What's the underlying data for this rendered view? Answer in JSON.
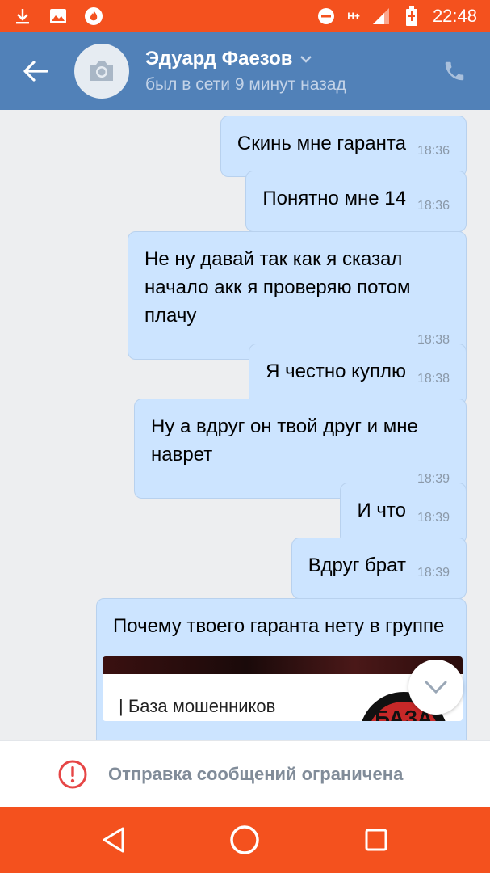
{
  "status_bar": {
    "time": "22:48",
    "network": "H+",
    "icons": [
      "download-icon",
      "image-icon",
      "fire-app-icon",
      "do-not-disturb-icon",
      "network-type-icon",
      "signal-icon",
      "battery-charging-icon"
    ]
  },
  "header": {
    "contact_name": "Эдуард Фаезов",
    "last_seen": "был в сети 9 минут назад"
  },
  "messages": [
    {
      "text": "Скинь мне гаранта",
      "time": "18:36"
    },
    {
      "text": "Понятно мне 14",
      "time": "18:36"
    },
    {
      "text": "Не ну давай так как я сказал начало акк я проверяю потом плачу",
      "time": "18:38"
    },
    {
      "text": "Я честно куплю",
      "time": "18:38"
    },
    {
      "text": "Ну а вдруг он твой друг и мне наврет",
      "time": "18:39"
    },
    {
      "text": "И что",
      "time": "18:39"
    },
    {
      "text": "Вдруг брат",
      "time": "18:39"
    },
    {
      "text": "Почему твоего гаранта нету в группе",
      "time": ""
    }
  ],
  "link_preview": {
    "title": "| База мошенников",
    "logo_text": "БАЗА"
  },
  "restriction_banner": {
    "text": "Отправка сообщений ограничена"
  },
  "colors": {
    "status_bar": "#f4511e",
    "header": "#5181b8",
    "bubble": "#cce4ff",
    "chat_bg": "#edeef0",
    "warning": "#e64646"
  }
}
